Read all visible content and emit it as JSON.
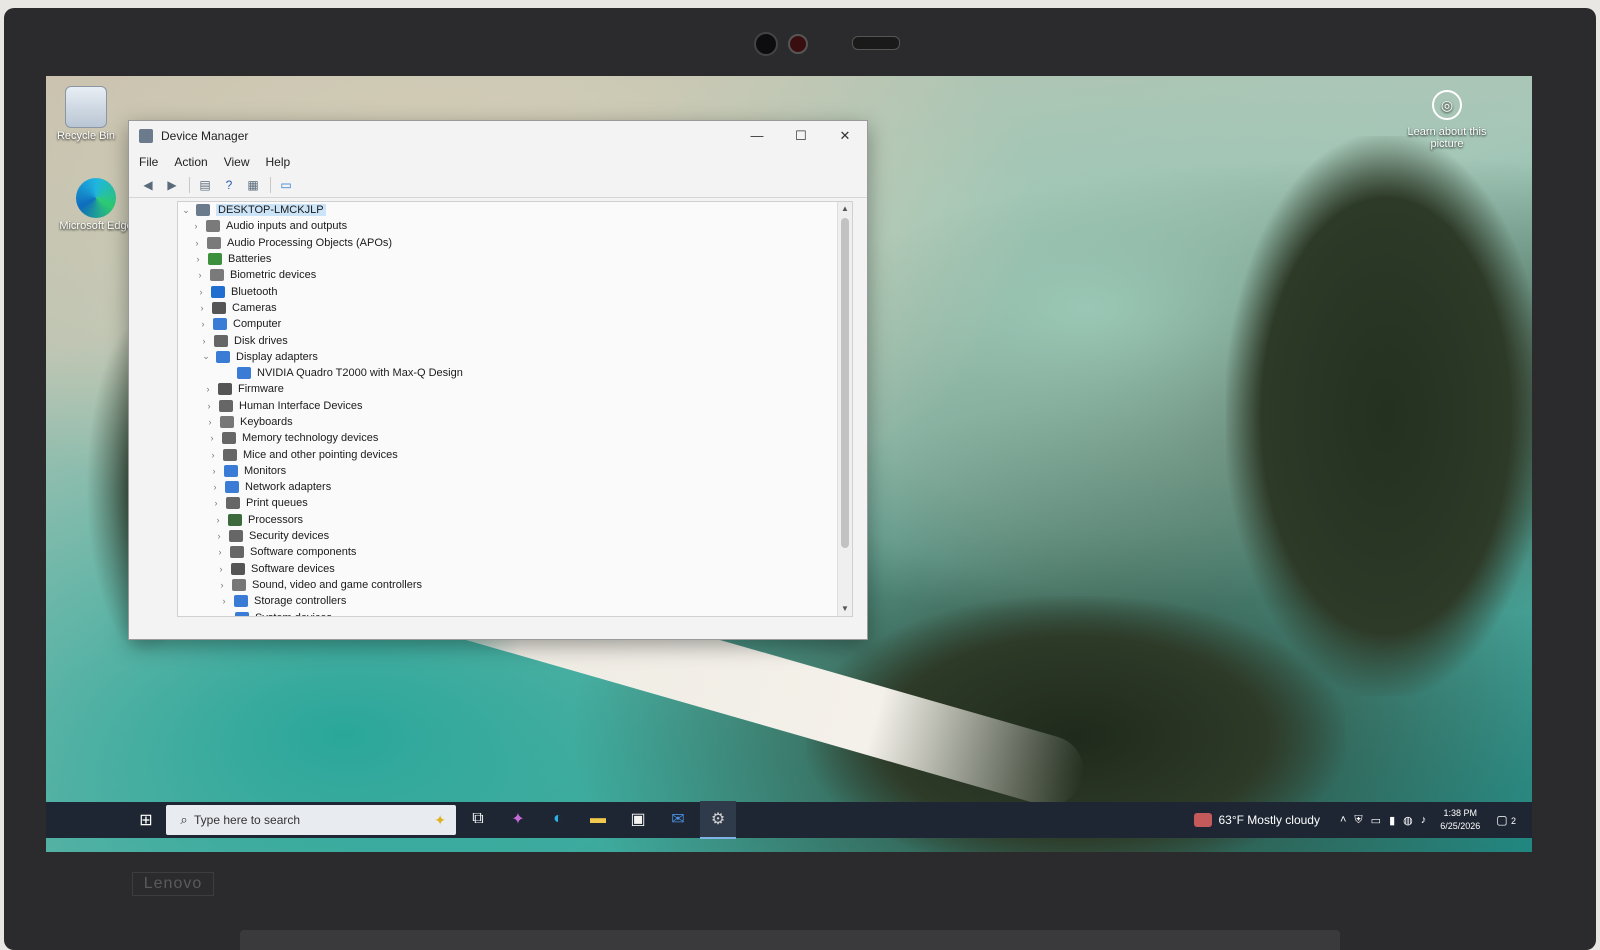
{
  "desktop": {
    "icons": [
      {
        "label": "Recycle Bin",
        "icon": "recycle-bin-icon"
      },
      {
        "label": "Microsoft Edge",
        "icon": "edge-icon"
      }
    ],
    "learn_about": "Learn about this picture"
  },
  "window": {
    "title": "Device Manager",
    "controls": {
      "minimize": "—",
      "maximize": "☐",
      "close": "✕"
    },
    "menu": [
      "File",
      "Action",
      "View",
      "Help"
    ],
    "toolbar_icons": [
      "back-icon",
      "forward-icon",
      "properties-icon",
      "help-icon",
      "update-driver-icon",
      "monitor-icon"
    ],
    "tree": {
      "root": "DESKTOP-LMCKJLP",
      "items": [
        {
          "label": "Audio inputs and outputs",
          "color": "#7a7a7a"
        },
        {
          "label": "Audio Processing Objects (APOs)",
          "color": "#7a7a7a"
        },
        {
          "label": "Batteries",
          "color": "#3c8f3c"
        },
        {
          "label": "Biometric devices",
          "color": "#7a7a7a"
        },
        {
          "label": "Bluetooth",
          "color": "#1f6fd1"
        },
        {
          "label": "Cameras",
          "color": "#555555"
        },
        {
          "label": "Computer",
          "color": "#3a7bd5"
        },
        {
          "label": "Disk drives",
          "color": "#666666"
        },
        {
          "label": "Display adapters",
          "color": "#3a7bd5",
          "expanded": true
        },
        {
          "label": "NVIDIA Quadro T2000 with Max-Q Design",
          "color": "#3a7bd5",
          "child": true
        },
        {
          "label": "Firmware",
          "color": "#555555"
        },
        {
          "label": "Human Interface Devices",
          "color": "#666666"
        },
        {
          "label": "Keyboards",
          "color": "#777777"
        },
        {
          "label": "Memory technology devices",
          "color": "#666666"
        },
        {
          "label": "Mice and other pointing devices",
          "color": "#666666"
        },
        {
          "label": "Monitors",
          "color": "#3a7bd5"
        },
        {
          "label": "Network adapters",
          "color": "#3a7bd5"
        },
        {
          "label": "Print queues",
          "color": "#666666"
        },
        {
          "label": "Processors",
          "color": "#3c6a3c"
        },
        {
          "label": "Security devices",
          "color": "#666666"
        },
        {
          "label": "Software components",
          "color": "#666666"
        },
        {
          "label": "Software devices",
          "color": "#555555"
        },
        {
          "label": "Sound, video and game controllers",
          "color": "#777777"
        },
        {
          "label": "Storage controllers",
          "color": "#3a7bd5"
        },
        {
          "label": "System devices",
          "color": "#3a7bd5"
        }
      ]
    }
  },
  "taskbar": {
    "search_placeholder": "Type here to search",
    "apps": [
      {
        "name": "task-view-icon",
        "glyph": "⧉"
      },
      {
        "name": "copilot-icon",
        "glyph": "✦"
      },
      {
        "name": "edge-icon",
        "glyph": "◐"
      },
      {
        "name": "file-explorer-icon",
        "glyph": "▬"
      },
      {
        "name": "store-icon",
        "glyph": "▣"
      },
      {
        "name": "outlook-icon",
        "glyph": "✉"
      },
      {
        "name": "device-manager-icon",
        "glyph": "⚙"
      }
    ],
    "weather": "63°F  Mostly cloudy",
    "time": "1:38 PM",
    "date": "6/25/2026",
    "notification_count": "2"
  },
  "bezel": {
    "brand": "Lenovo"
  }
}
